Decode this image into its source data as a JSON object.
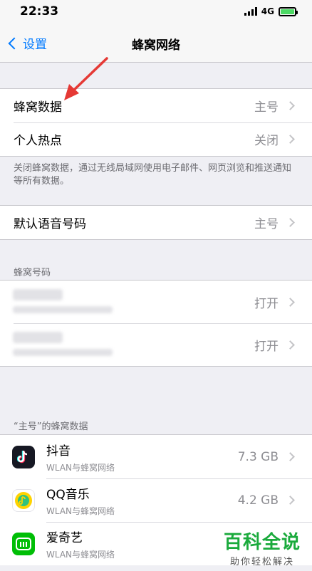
{
  "status": {
    "time": "22:33",
    "network": "4G"
  },
  "nav": {
    "back_label": "设置",
    "title": "蜂窝网络"
  },
  "group1": {
    "rows": [
      {
        "label": "蜂窝数据",
        "value": "主号"
      },
      {
        "label": "个人热点",
        "value": "关闭"
      }
    ],
    "footer": "关闭蜂窝数据，通过无线局域网使用电子邮件、网页浏览和推送通知等所有数据。"
  },
  "group2": {
    "rows": [
      {
        "label": "默认语音号码",
        "value": "主号"
      }
    ]
  },
  "sim_section": {
    "header": "蜂窝号码",
    "rows": [
      {
        "value": "打开"
      },
      {
        "value": "打开"
      }
    ]
  },
  "apps_section": {
    "header": "“主号”的蜂窝数据",
    "apps": [
      {
        "name": "抖音",
        "sub": "WLAN与蜂窝网络",
        "usage": "7.3 GB",
        "icon": "douyin-icon",
        "color": "#161823"
      },
      {
        "name": "QQ音乐",
        "sub": "WLAN与蜂窝网络",
        "usage": "4.2 GB",
        "icon": "qqmusic-icon",
        "color": "#ffffff"
      },
      {
        "name": "爱奇艺",
        "sub": "WLAN与蜂窝网络",
        "usage": "",
        "icon": "iqiyi-icon",
        "color": "#00be06"
      }
    ]
  },
  "watermark": {
    "main": "百科全说",
    "sub": "助你轻松解决"
  },
  "colors": {
    "accent": "#007aff",
    "arrow": "#e53935",
    "watermark": "#1aaa3c"
  }
}
